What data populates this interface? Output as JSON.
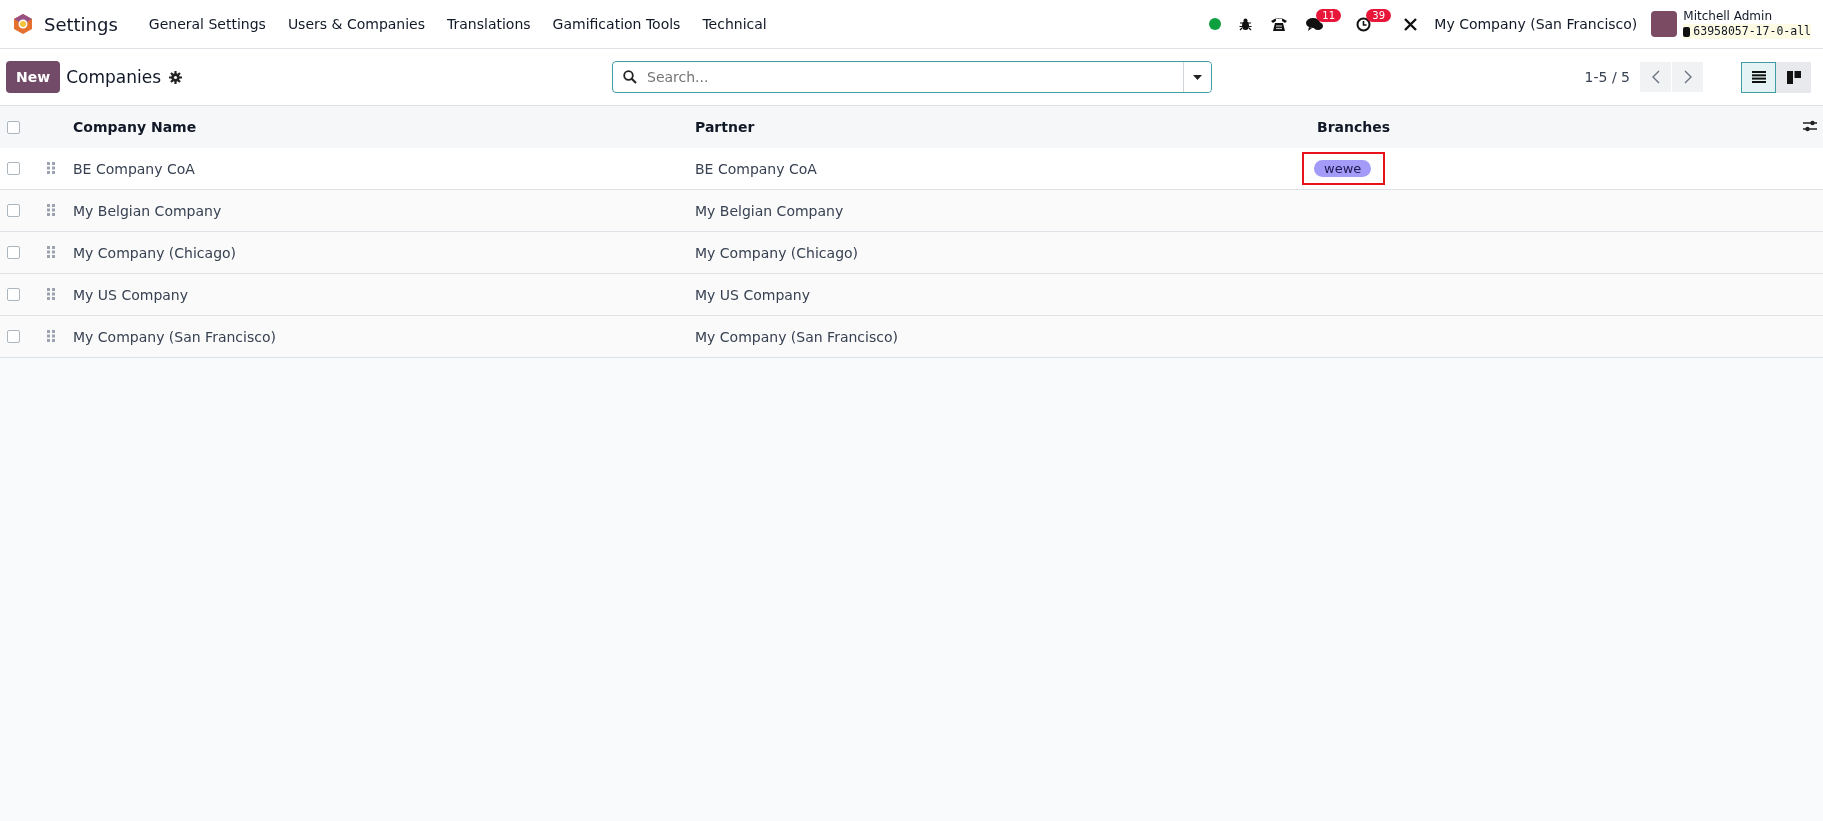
{
  "navbar": {
    "app_name": "Settings",
    "menu": [
      "General Settings",
      "Users & Companies",
      "Translations",
      "Gamification Tools",
      "Technical"
    ],
    "messages_badge": "11",
    "activities_badge": "39",
    "company": "My Company (San Francisco)",
    "user_name": "Mitchell Admin",
    "database": "63958057-17-0-all"
  },
  "control_panel": {
    "new_button": "New",
    "title": "Companies",
    "search": {
      "placeholder": "Search..."
    },
    "pager": "1-5 / 5",
    "views": [
      {
        "kind": "list",
        "selected": true
      },
      {
        "kind": "kanban",
        "selected": false
      }
    ]
  },
  "table": {
    "select_all_checked": false,
    "columns": [
      "Company Name",
      "Partner",
      "Branches"
    ],
    "rows": [
      {
        "checked": false,
        "company_name": "BE Company CoA",
        "partner": "BE Company CoA",
        "branches": [
          {
            "label": "wewe",
            "color": "#a29bf7",
            "highlighted": true
          }
        ]
      },
      {
        "checked": false,
        "company_name": "My Belgian Company",
        "partner": "My Belgian Company",
        "branches": []
      },
      {
        "checked": false,
        "company_name": "My Company (Chicago)",
        "partner": "My Company (Chicago)",
        "branches": []
      },
      {
        "checked": false,
        "company_name": "My US Company",
        "partner": "My US Company",
        "branches": []
      },
      {
        "checked": false,
        "company_name": "My Company (San Francisco)",
        "partner": "My Company (San Francisco)",
        "branches": []
      }
    ]
  }
}
